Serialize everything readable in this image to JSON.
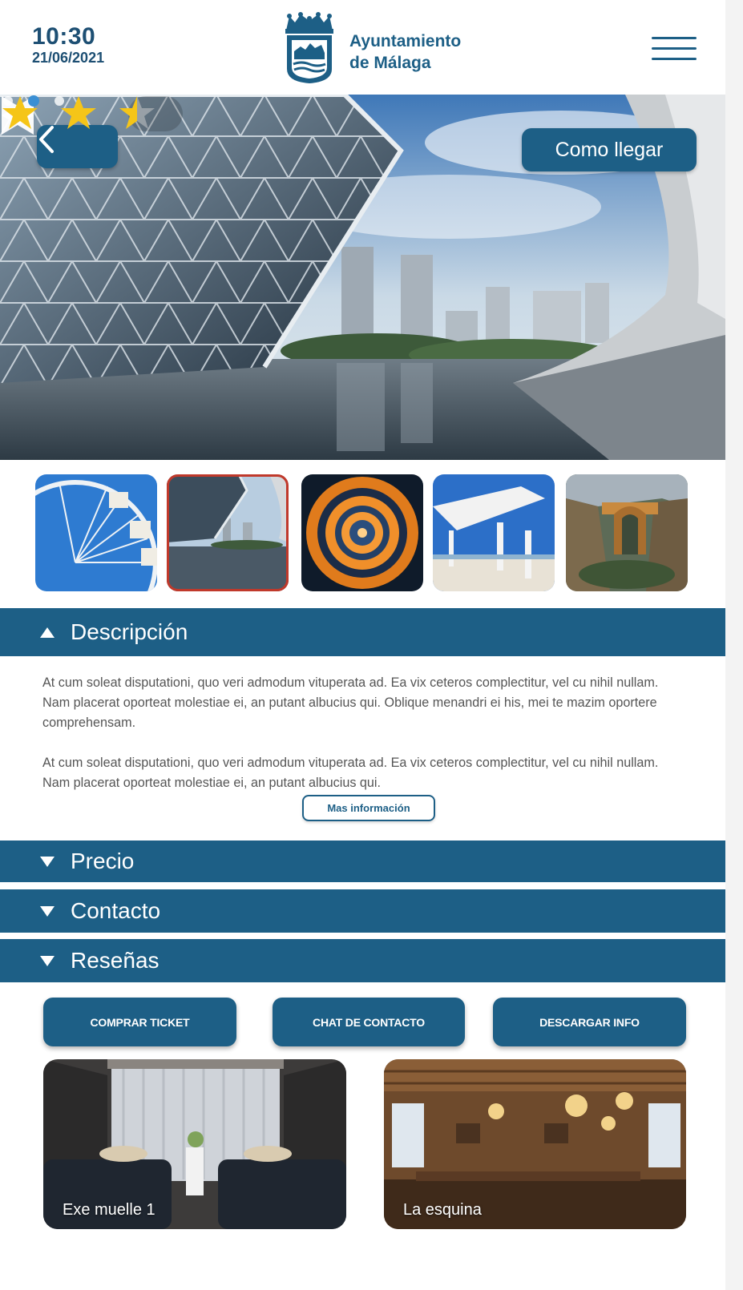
{
  "header": {
    "time": "10:30",
    "date": "21/06/2021",
    "brand_line1": "Ayuntamiento",
    "brand_line2": "de Málaga",
    "logo_icon": "malaga-coat-of-arms",
    "menu_icon": "hamburger-icon"
  },
  "hero": {
    "route_button_label": "Como llegar",
    "back_icon": "chevron-left-icon",
    "rating": {
      "value": 2.5,
      "max": 3
    },
    "carousel": {
      "slides": 3,
      "active_slide": 2
    }
  },
  "thumbnails": [
    {
      "name": "noria",
      "selected": false
    },
    {
      "name": "edificio-moderno",
      "selected": true
    },
    {
      "name": "escalera-espiral",
      "selected": false
    },
    {
      "name": "paseo-pergola",
      "selected": false
    },
    {
      "name": "ronda-puente",
      "selected": false
    }
  ],
  "sections": {
    "descripcion": "Descripción",
    "precio": "Precio",
    "contacto": "Contacto",
    "resenas": "Reseñas"
  },
  "description": {
    "paragraph1": "At cum soleat disputationi, quo veri admodum vituperata ad. Ea vix ceteros complectitur, vel cu nihil nullam. Nam placerat oporteat molestiae ei, an putant albucius qui. Oblique menandri ei his, mei te mazim oportere comprehensam.",
    "paragraph2": "At cum soleat disputationi, quo veri admodum vituperata ad. Ea vix ceteros complectitur, vel cu nihil nullam. Nam placerat oporteat molestiae ei, an putant albucius qui.",
    "more_button": "Mas información"
  },
  "actions": {
    "buy": "COMPRAR TICKET",
    "chat": "CHAT DE CONTACTO",
    "download": "DESCARGAR INFO"
  },
  "cards": [
    {
      "title": "Exe muelle 1"
    },
    {
      "title": "La esquina"
    }
  ],
  "colors": {
    "primary": "#1d5f86",
    "selected_border": "#c0392b",
    "star": "#f5c518"
  }
}
